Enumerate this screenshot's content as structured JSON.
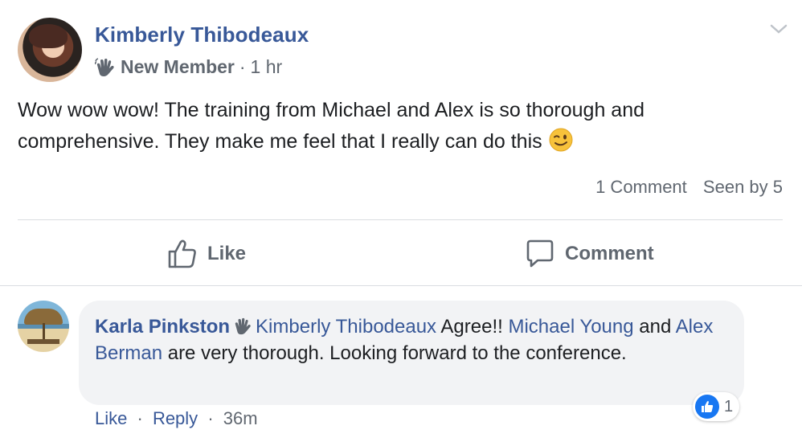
{
  "post": {
    "author": "Kimberly Thibodeaux",
    "badge": "New Member",
    "separator": "·",
    "time": "1 hr",
    "text": "Wow wow wow! The training from Michael and Alex is so thorough and comprehensive. They make me feel that I really can do this",
    "emoji": "wink-emoji",
    "stats": {
      "comments": "1 Comment",
      "seen": "Seen by 5"
    }
  },
  "actions": {
    "like_label": "Like",
    "comment_label": "Comment"
  },
  "comment": {
    "author": "Karla Pinkston",
    "mention": "Kimberly Thibodeaux",
    "text_1": "Agree!!",
    "mention_2": "Michael Young",
    "text_2": "and",
    "mention_3": "Alex Berman",
    "text_3": "are very thorough. Looking forward to the conference.",
    "reaction_count": "1",
    "like_label": "Like",
    "reply_label": "Reply",
    "separator": "·",
    "time": "36m"
  },
  "icons": [
    "wave-icon",
    "chevron-down-icon",
    "thumbs-up-icon",
    "comment-icon",
    "wink-emoji-icon",
    "like-reaction-icon"
  ],
  "colors": {
    "link": "#385898",
    "meta": "#606770",
    "bubble": "#f2f3f5",
    "like_blue": "#1877f2"
  }
}
